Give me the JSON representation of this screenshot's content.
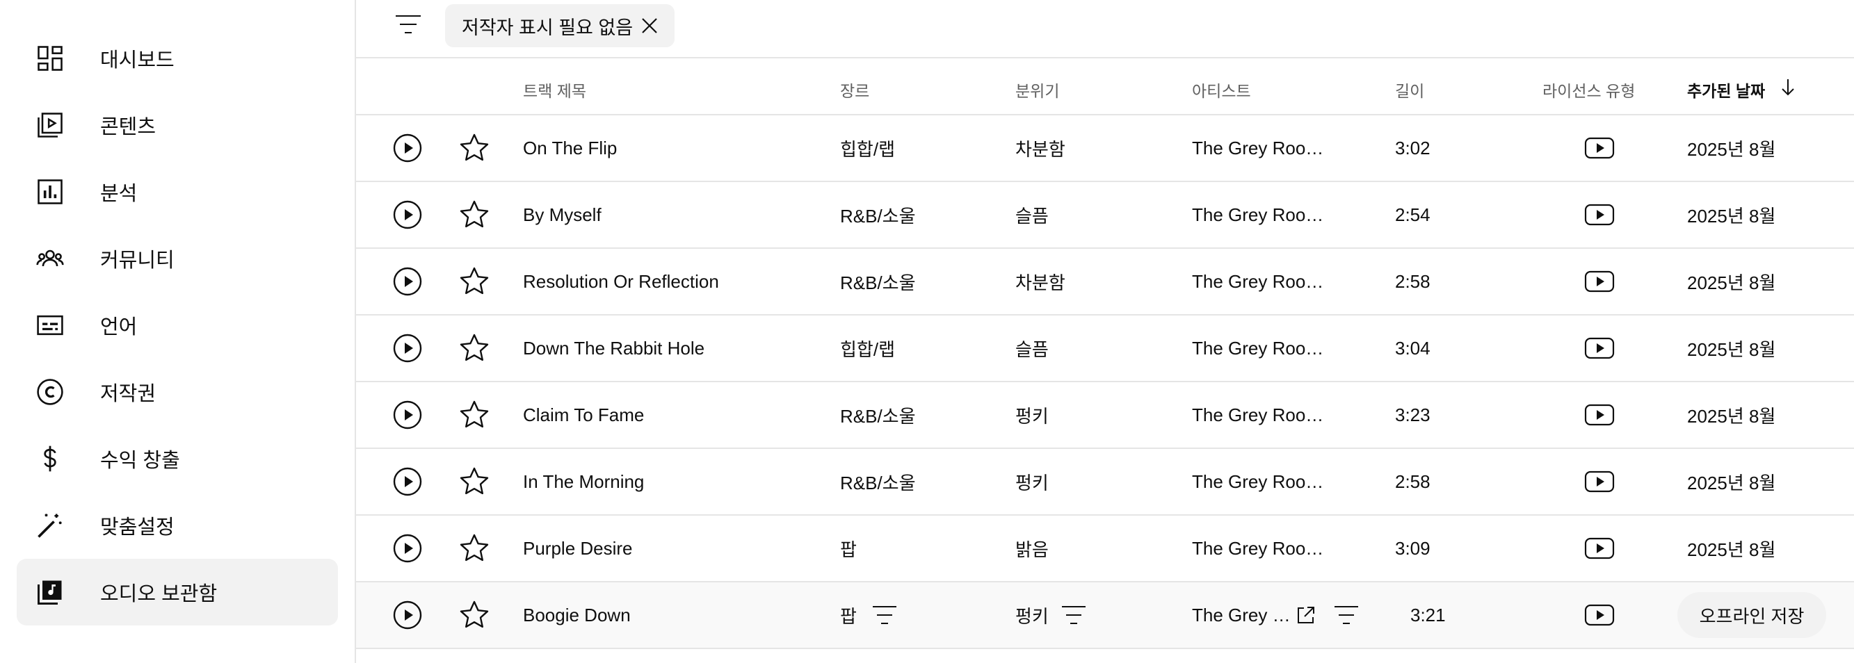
{
  "sidebar": {
    "items": [
      {
        "label": "대시보드",
        "icon": "dashboard-icon"
      },
      {
        "label": "콘텐츠",
        "icon": "content-icon"
      },
      {
        "label": "분석",
        "icon": "analytics-icon"
      },
      {
        "label": "커뮤니티",
        "icon": "community-icon"
      },
      {
        "label": "언어",
        "icon": "subtitles-icon"
      },
      {
        "label": "저작권",
        "icon": "copyright-icon"
      },
      {
        "label": "수익 창출",
        "icon": "dollar-icon"
      },
      {
        "label": "맞춤설정",
        "icon": "magic-wand-icon"
      },
      {
        "label": "오디오 보관함",
        "icon": "audio-library-icon",
        "active": true
      }
    ]
  },
  "toolbar": {
    "filter_icon": "filter-icon",
    "chip_label": "저작자 표시 필요 없음",
    "chip_close_icon": "close-icon"
  },
  "table": {
    "headers": {
      "title": "트랙 제목",
      "genre": "장르",
      "mood": "분위기",
      "artist": "아티스트",
      "duration": "길이",
      "license": "라이선스 유형",
      "added": "추가된 날짜"
    },
    "rows": [
      {
        "title": "On The Flip",
        "genre": "힙합/랩",
        "mood": "차분함",
        "artist": "The Grey Roo…",
        "duration": "3:02",
        "added": "2025년 8월"
      },
      {
        "title": "By Myself",
        "genre": "R&B/소울",
        "mood": "슬픔",
        "artist": "The Grey Roo…",
        "duration": "2:54",
        "added": "2025년 8월"
      },
      {
        "title": "Resolution Or Reflection",
        "genre": "R&B/소울",
        "mood": "차분함",
        "artist": "The Grey Roo…",
        "duration": "2:58",
        "added": "2025년 8월"
      },
      {
        "title": "Down The Rabbit Hole",
        "genre": "힙합/랩",
        "mood": "슬픔",
        "artist": "The Grey Roo…",
        "duration": "3:04",
        "added": "2025년 8월"
      },
      {
        "title": "Claim To Fame",
        "genre": "R&B/소울",
        "mood": "펑키",
        "artist": "The Grey Roo…",
        "duration": "3:23",
        "added": "2025년 8월"
      },
      {
        "title": "In The Morning",
        "genre": "R&B/소울",
        "mood": "펑키",
        "artist": "The Grey Roo…",
        "duration": "2:58",
        "added": "2025년 8월"
      },
      {
        "title": "Purple Desire",
        "genre": "팝",
        "mood": "밝음",
        "artist": "The Grey Roo…",
        "duration": "3:09",
        "added": "2025년 8월"
      }
    ],
    "hover_row": {
      "title": "Boogie Down",
      "genre": "팝",
      "mood": "펑키",
      "artist": "The Grey …",
      "duration": "3:21",
      "offline_label": "오프라인 저장"
    }
  }
}
